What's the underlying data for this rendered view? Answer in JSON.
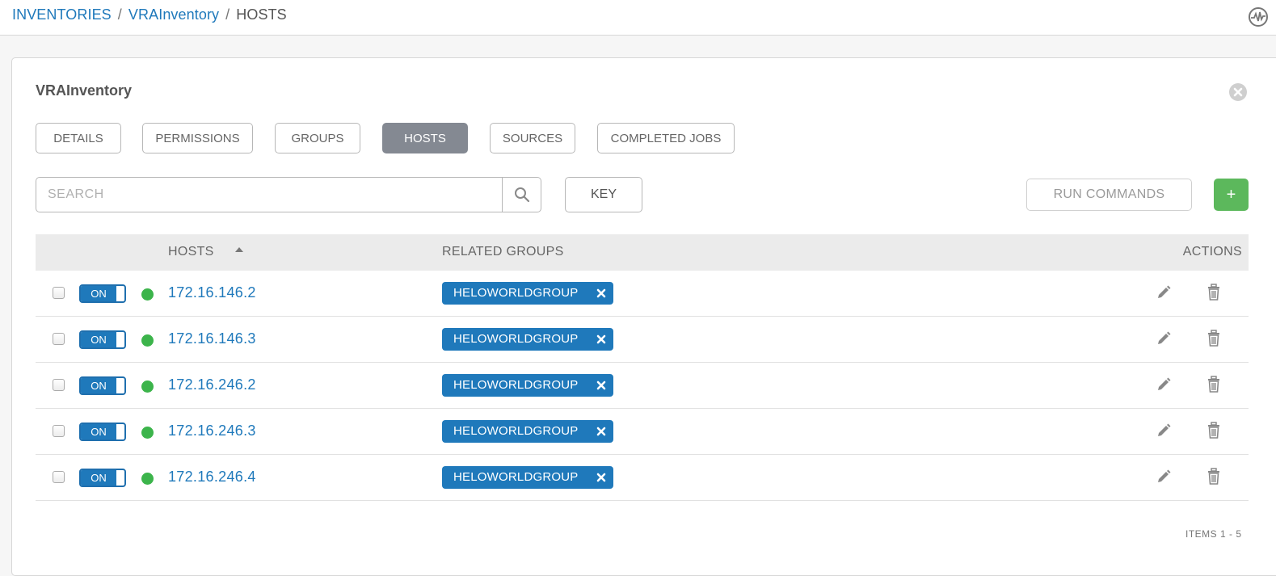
{
  "breadcrumb": {
    "items": [
      {
        "label": "INVENTORIES"
      },
      {
        "label": "VRAInventory"
      },
      {
        "label": "HOSTS"
      }
    ],
    "separator": "/"
  },
  "card": {
    "title": "VRAInventory"
  },
  "tabs": [
    {
      "label": "DETAILS",
      "active": false
    },
    {
      "label": "PERMISSIONS",
      "active": false
    },
    {
      "label": "GROUPS",
      "active": false
    },
    {
      "label": "HOSTS",
      "active": true
    },
    {
      "label": "SOURCES",
      "active": false
    },
    {
      "label": "COMPLETED JOBS",
      "active": false
    }
  ],
  "search": {
    "placeholder": "SEARCH",
    "value": ""
  },
  "toolbar": {
    "key_label": "KEY",
    "run_commands_label": "RUN COMMANDS",
    "add_label": "+"
  },
  "table": {
    "columns": {
      "hosts": "HOSTS",
      "related_groups": "RELATED GROUPS",
      "actions": "ACTIONS"
    },
    "sort": {
      "column": "hosts",
      "direction": "ascending"
    },
    "rows": [
      {
        "enabled_label": "ON",
        "host": "172.16.146.2",
        "group": "HELOWORLDGROUP",
        "status": "ok"
      },
      {
        "enabled_label": "ON",
        "host": "172.16.146.3",
        "group": "HELOWORLDGROUP",
        "status": "ok"
      },
      {
        "enabled_label": "ON",
        "host": "172.16.246.2",
        "group": "HELOWORLDGROUP",
        "status": "ok"
      },
      {
        "enabled_label": "ON",
        "host": "172.16.246.3",
        "group": "HELOWORLDGROUP",
        "status": "ok"
      },
      {
        "enabled_label": "ON",
        "host": "172.16.246.4",
        "group": "HELOWORLDGROUP",
        "status": "ok"
      }
    ]
  },
  "pagination": {
    "items_label": "ITEMS  1 - 5"
  },
  "colors": {
    "link": "#1f79bb",
    "active_tab": "#848992",
    "add_button": "#5cb85c",
    "status_ok": "#3cb44b",
    "tag": "#1f79bb"
  },
  "icons": {
    "activity": "activity-stream-icon",
    "close": "close-circle-icon",
    "search": "search-icon",
    "sort": "sort-ascending-icon",
    "remove": "remove-x-icon",
    "edit": "pencil-icon",
    "delete": "trash-icon"
  }
}
